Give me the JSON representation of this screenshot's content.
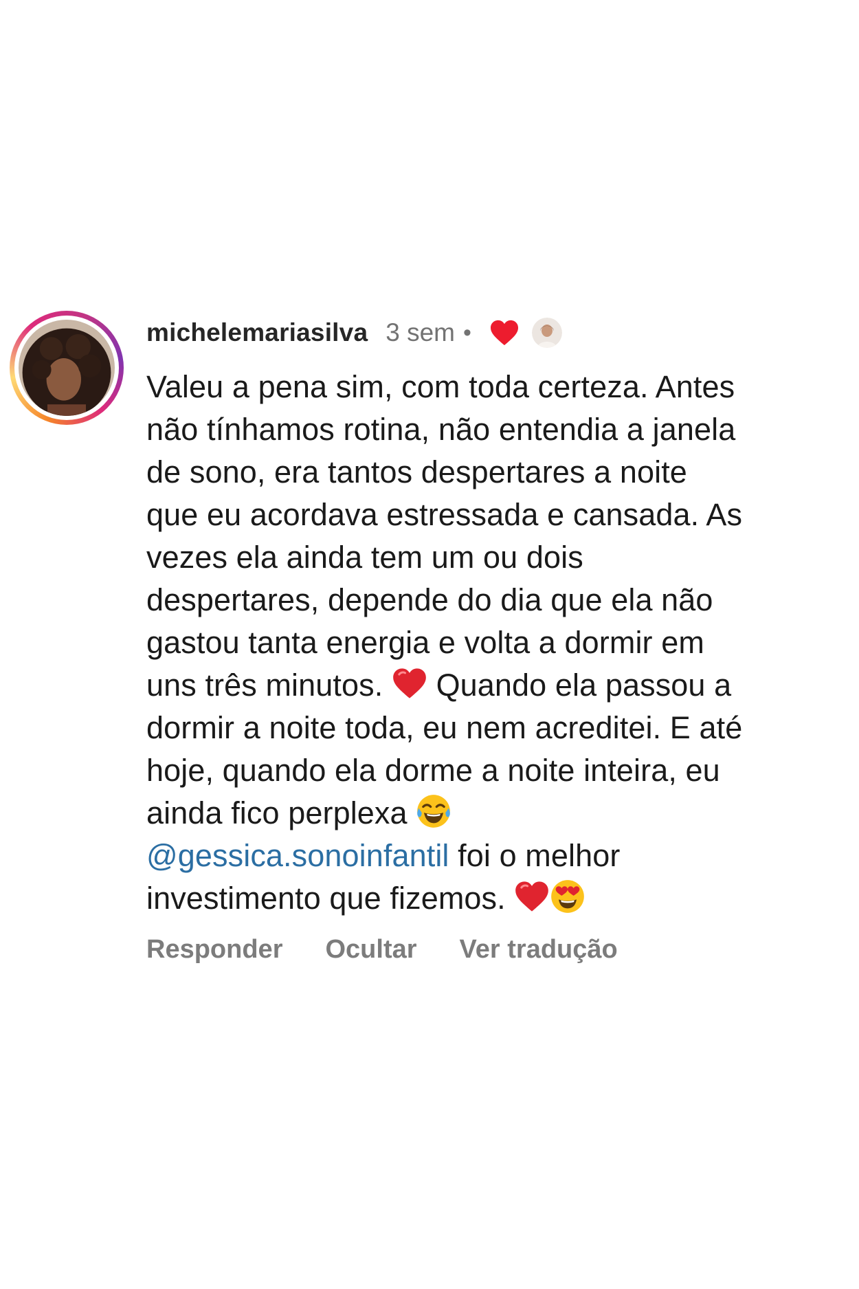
{
  "comment": {
    "username": "michelemariasilva",
    "time": "3 sem",
    "separator": "•",
    "liked_by_creator_icon": "heart-icon",
    "creator_avatar_icon": "creator-avatar-icon",
    "lines": [
      "Valeu a pena sim, com toda certeza. Antes",
      "não tínhamos rotina, não entendia a janela",
      "de sono, era tantos despertares a noite",
      "que eu acordava estressada e cansada. As",
      "vezes ela ainda tem um ou dois",
      "despertares, depende do dia que ela não",
      "gastou tanta energia e volta a dormir em"
    ],
    "line8_before": "uns três minutos.",
    "line8_after": "Quando ela passou a",
    "line9": "dormir a noite toda, eu nem acreditei. E até",
    "line10": "hoje, quando ela dorme a noite inteira, eu",
    "line11": "ainda fico perplexa",
    "mention": "@gessica.sonoinfantil",
    "line12_after": " foi o melhor",
    "line13": "investimento que fizemos.",
    "emojis": [
      "red-heart-emoji",
      "tears-of-joy-emoji",
      "heart-eyes-emoji"
    ]
  },
  "actions": {
    "reply_label": "Responder",
    "hide_label": "Ocultar",
    "translate_label": "Ver tradução"
  },
  "colors": {
    "heart": "#ed1c2e",
    "mention": "#2b6ea3",
    "muted": "#737373"
  }
}
